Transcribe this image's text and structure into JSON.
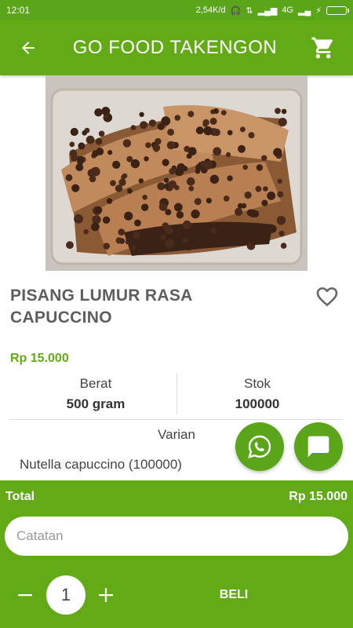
{
  "status_bar": {
    "time": "12:01",
    "network_speed": "2,54K/d",
    "network_type": "4G"
  },
  "header": {
    "title": "GO FOOD TAKENGON",
    "back_icon": "arrow-left-icon",
    "cart_icon": "shopping-cart-icon"
  },
  "product": {
    "image_alt": "",
    "name": "PISANG LUMUR RASA CAPUCCINO",
    "price": "Rp 15.000",
    "specs": [
      {
        "label": "Berat",
        "value": "500 gram"
      },
      {
        "label": "Stok",
        "value": "100000"
      }
    ],
    "variant_label": "Varian",
    "variant_option": "Nutella capuccino (100000)"
  },
  "fabs": {
    "whatsapp_icon": "whatsapp-icon",
    "chat_icon": "chat-bubble-icon"
  },
  "checkout": {
    "total_label": "Total",
    "total_value": "Rp 15.000",
    "note_placeholder": "Catatan",
    "quantity": "1",
    "buy_label": "BELI"
  },
  "colors": {
    "primary_green": "#62ab17",
    "status_green": "#5aa51a",
    "text_gray": "#5e5e5e"
  }
}
